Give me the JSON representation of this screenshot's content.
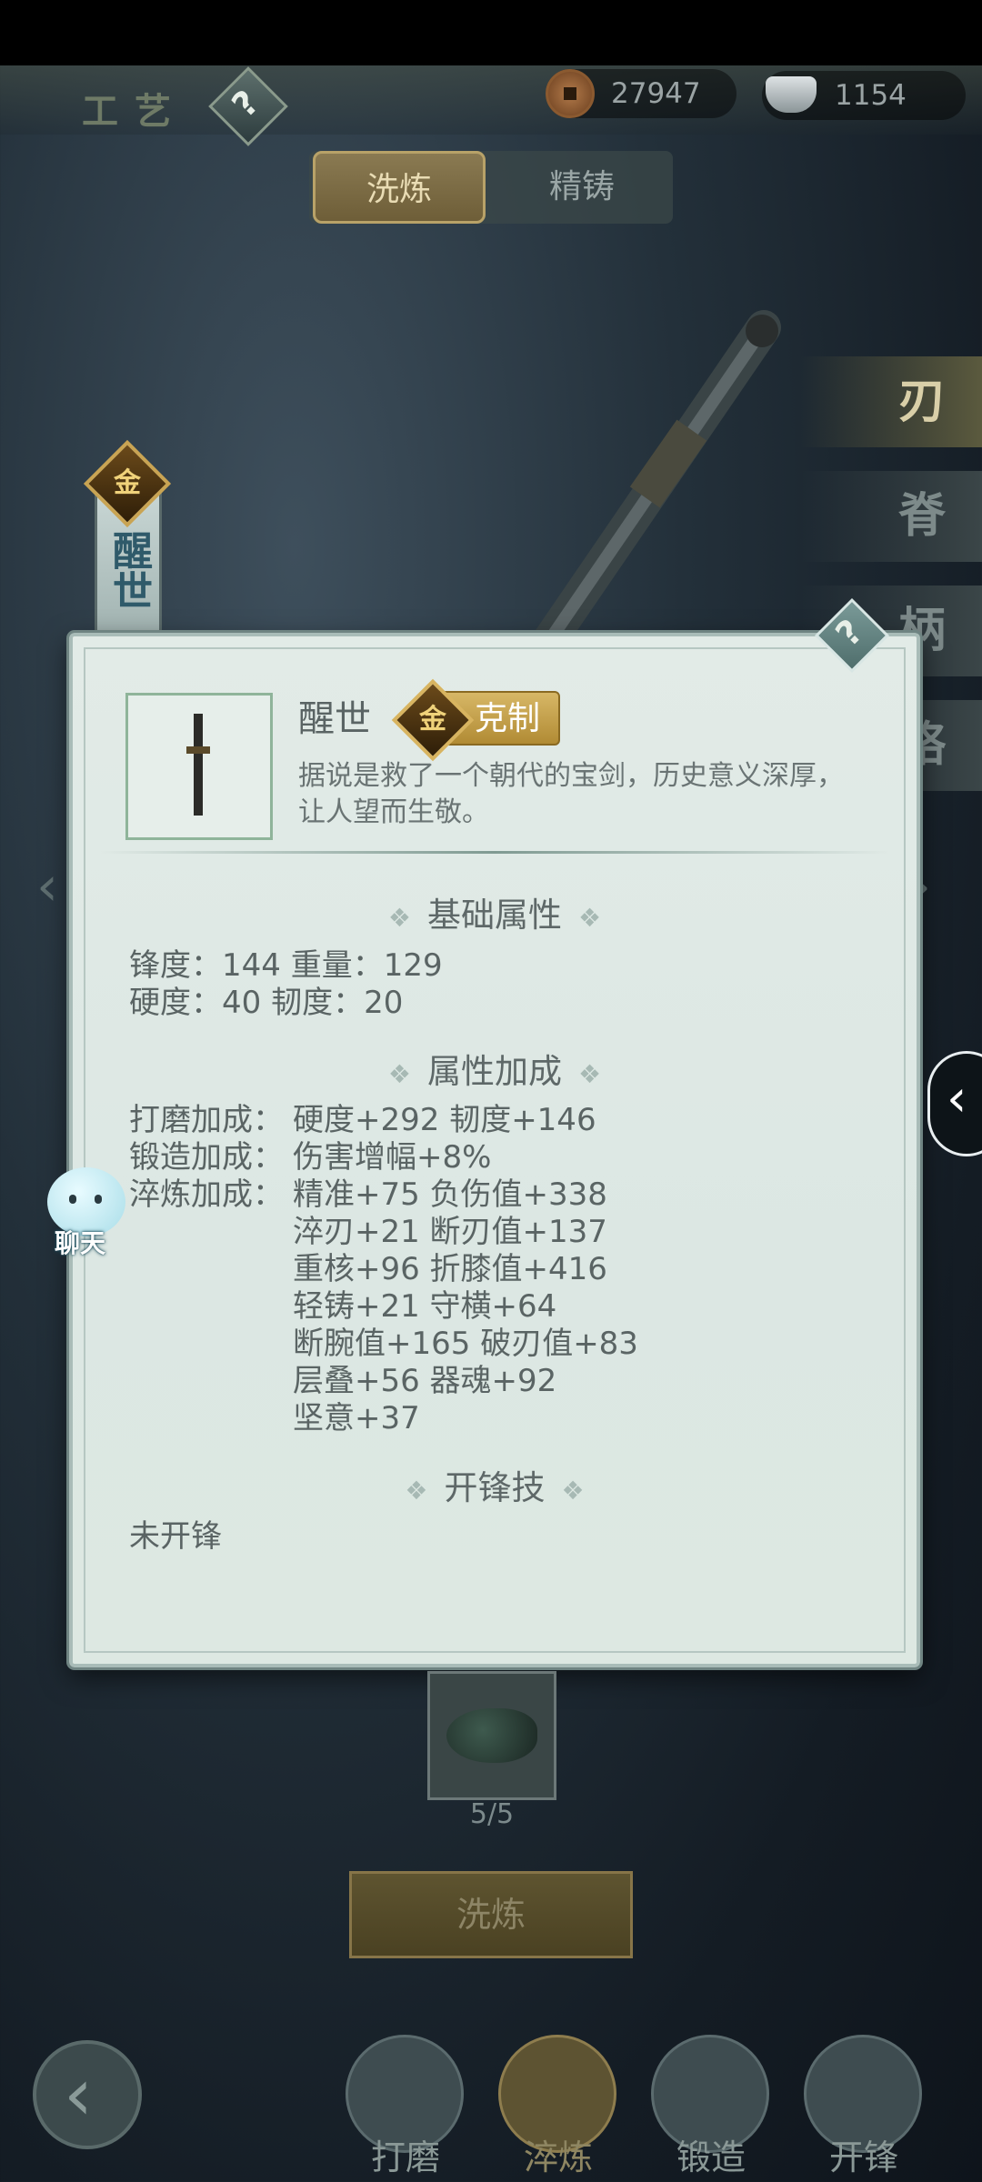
{
  "header": {
    "title": "工艺",
    "coins": "27947",
    "silver": "1154"
  },
  "tabs": [
    "洗炼",
    "精铸"
  ],
  "side_tabs": [
    "刃",
    "脊",
    "柄",
    "铬"
  ],
  "left_banner": {
    "badge": "金",
    "text": "醒世"
  },
  "dialog": {
    "name": "醒世",
    "badge_icon": "金",
    "badge_label": "克制",
    "description_line1": "据说是救了一个朝代的宝剑，历史意义深厚，",
    "description_line2": "让人望而生敬。",
    "section_basic": "基础属性",
    "basic": [
      "锋度：144  重量：129",
      "硬度：40  韧度：20"
    ],
    "section_bonus": "属性加成",
    "bonus": [
      {
        "label": "打磨加成：",
        "value": "硬度+292  韧度+146"
      },
      {
        "label": "锻造加成：",
        "value": "伤害增幅+8%"
      },
      {
        "label": "淬炼加成：",
        "value": "精准+75  负伤值+338"
      },
      {
        "label": "",
        "value": "淬刃+21  断刃值+137"
      },
      {
        "label": "",
        "value": "重核+96  折膝值+416"
      },
      {
        "label": "",
        "value": "轻铸+21  守横+64"
      },
      {
        "label": "",
        "value": "断腕值+165  破刃值+83"
      },
      {
        "label": "",
        "value": "层叠+56  器魂+92"
      },
      {
        "label": "",
        "value": "坚意+37"
      }
    ],
    "section_skill": "开锋技",
    "skill": "未开锋"
  },
  "chat_label": "聊天",
  "material_count": "5/5",
  "main_button": "洗炼",
  "bottom_nav": [
    "打磨",
    "淬炼",
    "锻造",
    "开锋"
  ]
}
